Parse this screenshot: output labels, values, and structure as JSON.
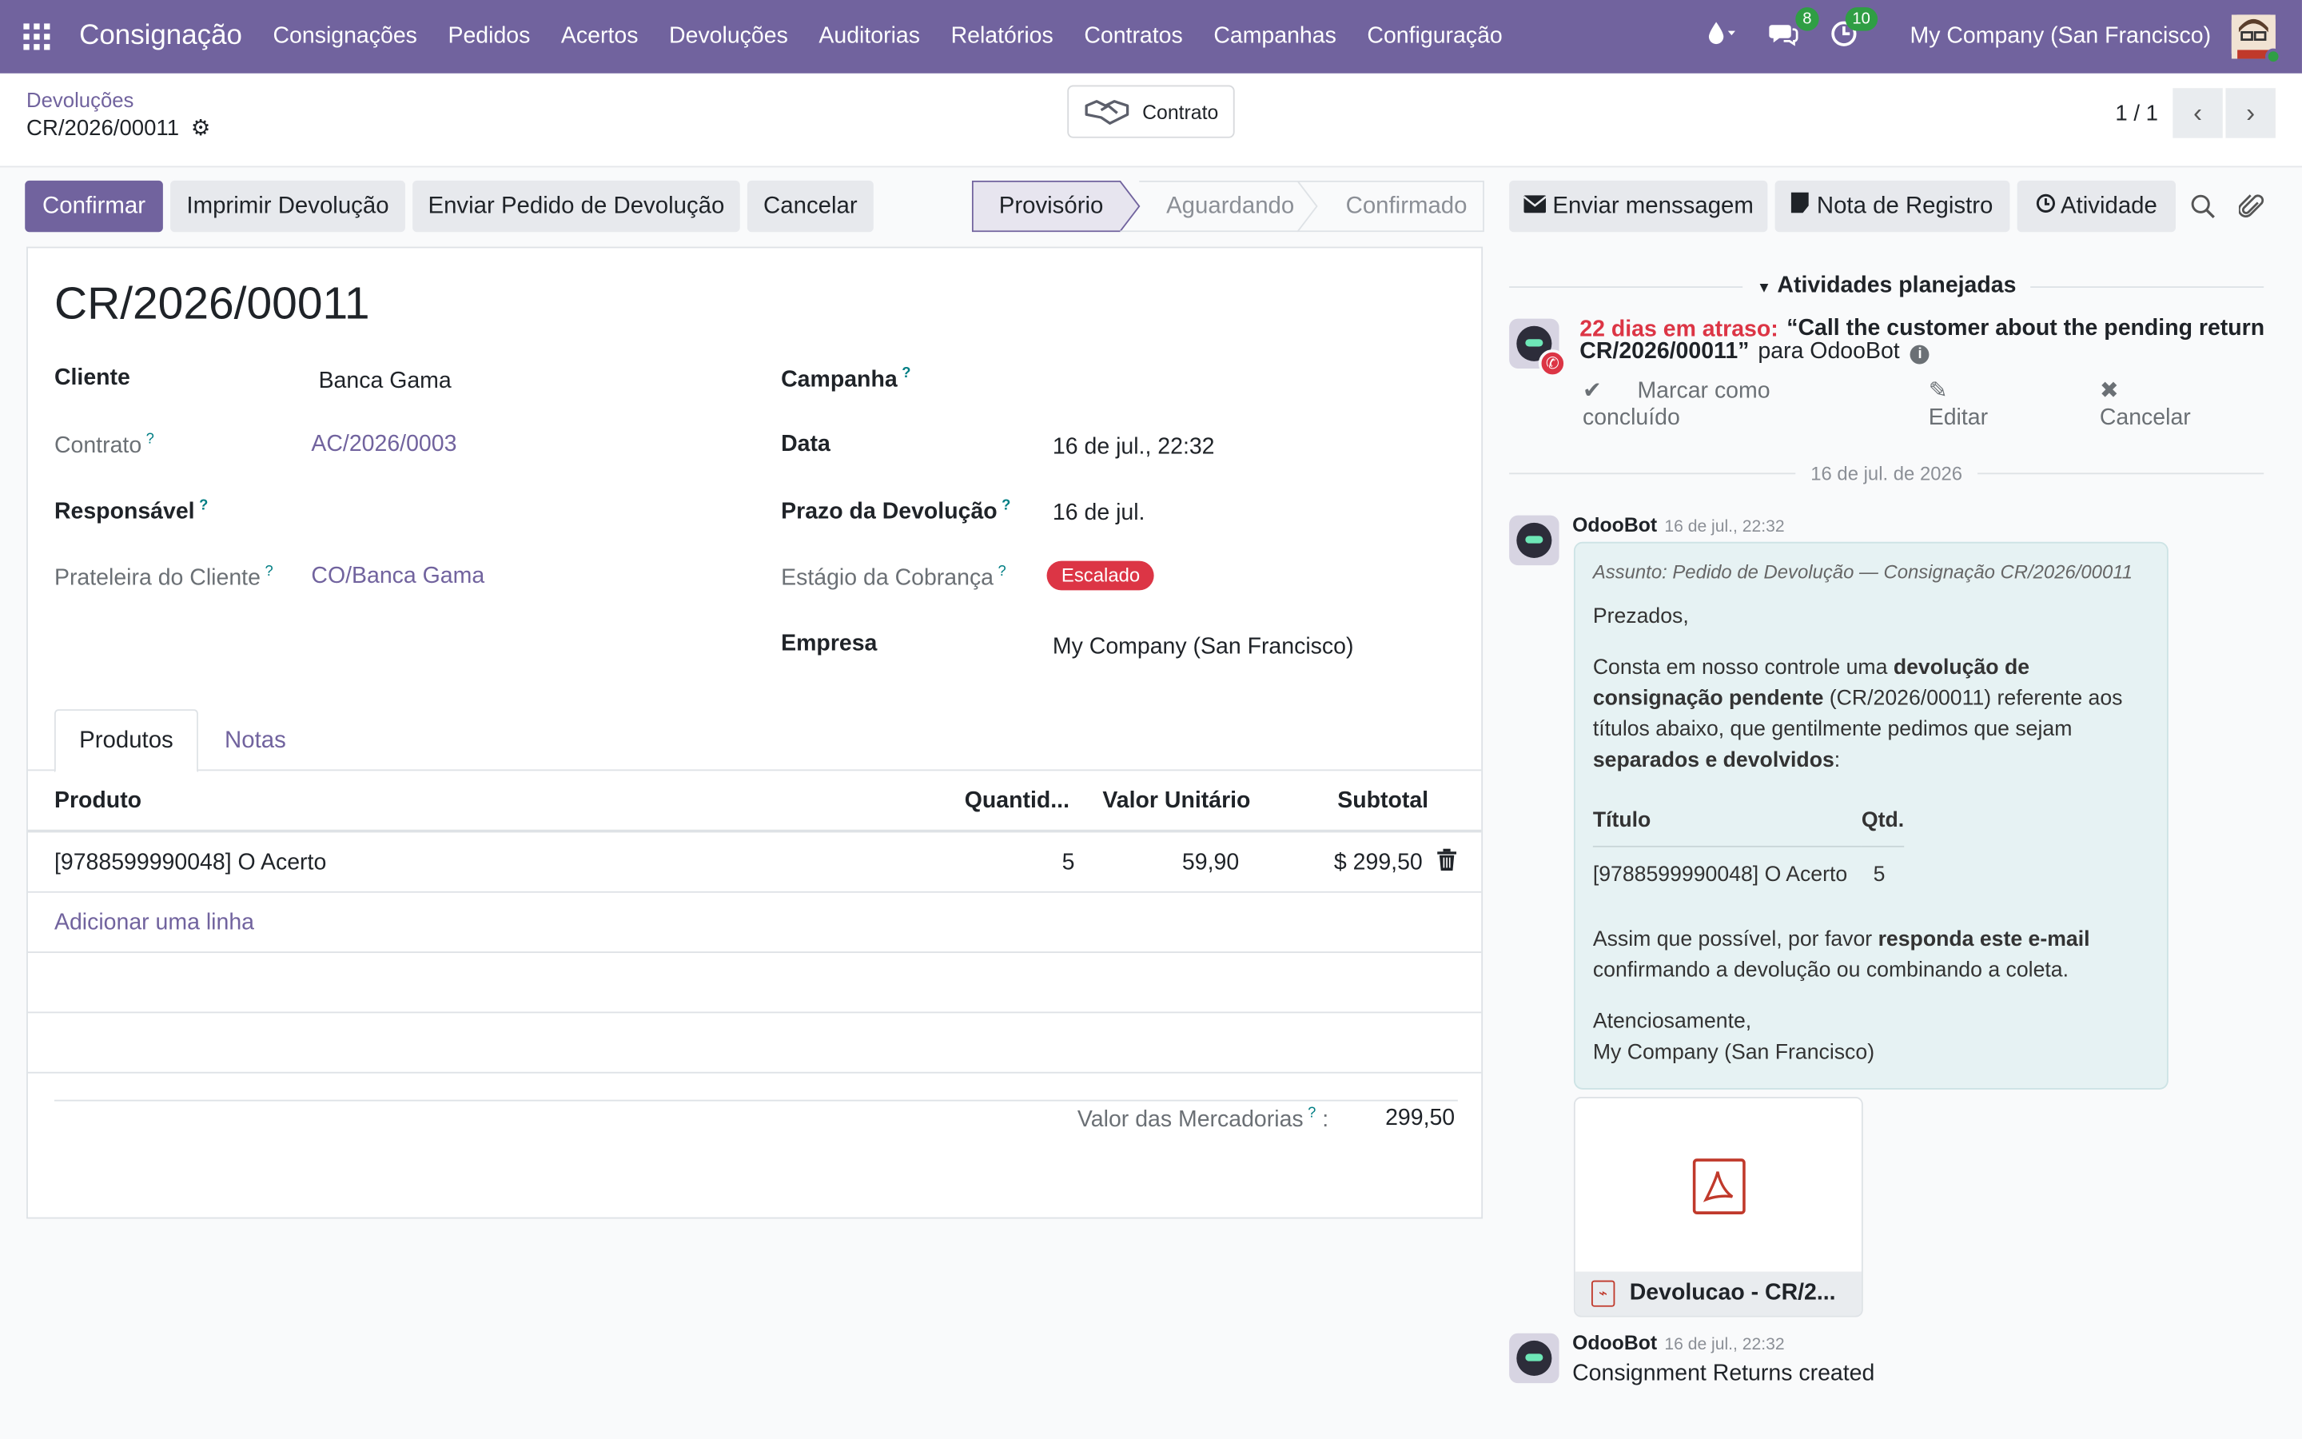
{
  "navbar": {
    "brand": "Consignação",
    "menu": [
      "Consignações",
      "Pedidos",
      "Acertos",
      "Devoluções",
      "Auditorias",
      "Relatórios",
      "Contratos",
      "Campanhas",
      "Configuração"
    ],
    "messages_count": "8",
    "activities_count": "10",
    "company": "My Company (San Francisco)"
  },
  "control": {
    "breadcrumb_parent": "Devoluções",
    "breadcrumb_current": "CR/2026/00011",
    "contract_button": "Contrato",
    "pager": "1 / 1"
  },
  "actions": {
    "confirm": "Confirmar",
    "print": "Imprimir Devolução",
    "send": "Enviar Pedido de Devolução",
    "cancel": "Cancelar"
  },
  "status": {
    "stages": [
      "Provisório",
      "Aguardando",
      "Confirmado"
    ],
    "active": "Provisório"
  },
  "chatter_buttons": {
    "send_message": "Enviar menssagem",
    "log_note": "Nota de Registro",
    "activity": "Atividade"
  },
  "form": {
    "title": "CR/2026/00011",
    "left": {
      "customer_label": "Cliente",
      "customer_value": "Banca Gama",
      "contract_label": "Contrato",
      "contract_value": "AC/2026/0003",
      "responsible_label": "Responsável",
      "shelf_label": "Prateleira do Cliente",
      "shelf_value": "CO/Banca Gama"
    },
    "right": {
      "campaign_label": "Campanha",
      "date_label": "Data",
      "date_value": "16 de jul., 22:32",
      "deadline_label": "Prazo da Devolução",
      "deadline_value": "16 de jul.",
      "collection_label": "Estágio da Cobrança",
      "collection_value": "Escalado",
      "company_label": "Empresa",
      "company_value": "My Company (San Francisco)"
    },
    "tabs": [
      "Produtos",
      "Notas"
    ],
    "table": {
      "headers": [
        "Produto",
        "Quantid...",
        "Valor Unitário",
        "Subtotal"
      ],
      "rows": [
        {
          "product": "[9788599990048] O Acerto",
          "qty": "5",
          "unit": "59,90",
          "subtotal": "$ 299,50"
        }
      ],
      "add_line": "Adicionar uma linha"
    },
    "total_label": "Valor das Mercadorias",
    "total_value": "299,50"
  },
  "chatter": {
    "planned_header": "Atividades planejadas",
    "late": "22 dias em atraso:",
    "activity_summary": "“Call the customer about the pending return CR/2026/00011”",
    "activity_for": "para OdooBot",
    "mark_done": "Marcar como concluído",
    "edit": "Editar",
    "cancel": "Cancelar",
    "date_separator": "16 de jul. de 2026",
    "msg1": {
      "author": "OdooBot",
      "date": "16 de jul., 22:32",
      "subject": "Assunto: Pedido de Devolução — Consignação CR/2026/00011",
      "greeting": "Prezados,",
      "p1_a": "Consta em nosso controle uma ",
      "p1_b": "devolução de consignação pendente",
      "p1_c": " (CR/2026/00011) referente aos títulos abaixo, que gentilmente pedimos que sejam ",
      "p1_d": "separados e devolvidos",
      "p1_e": ":",
      "th_title": "Título",
      "th_qty": "Qtd.",
      "td_title": "[9788599990048] O Acerto",
      "td_qty": "5",
      "p2_a": "Assim que possível, por favor ",
      "p2_b": "responda este e-mail",
      "p2_c": " confirmando a devolução ou combinando a coleta.",
      "sign1": "Atenciosamente,",
      "sign2": "My Company (San Francisco)",
      "attachment": "Devolucao - CR/2..."
    },
    "msg2": {
      "author": "OdooBot",
      "date": "16 de jul., 22:32",
      "body": "Consignment Returns created"
    }
  }
}
